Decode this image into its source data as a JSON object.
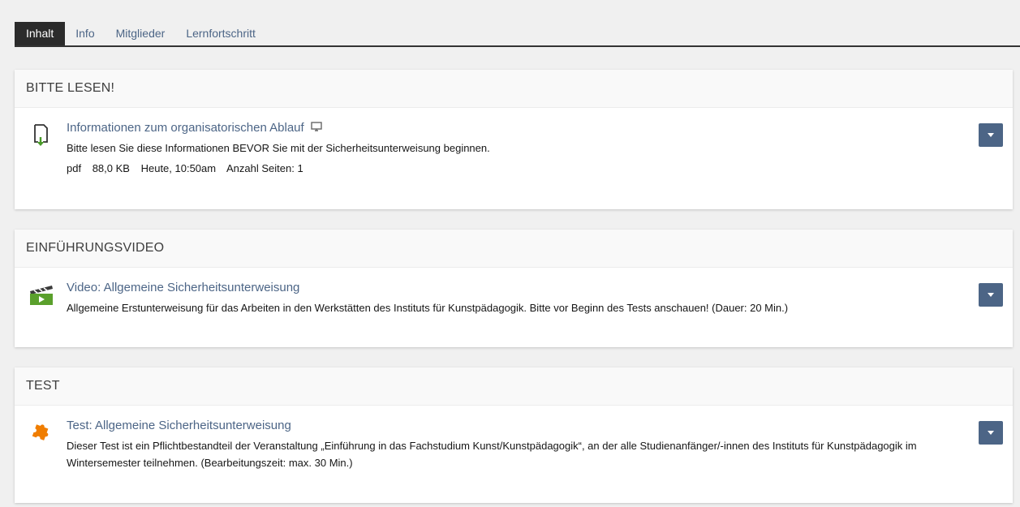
{
  "tabs": [
    {
      "label": "Inhalt",
      "active": true
    },
    {
      "label": "Info",
      "active": false
    },
    {
      "label": "Mitglieder",
      "active": false
    },
    {
      "label": "Lernfortschritt",
      "active": false
    }
  ],
  "blocks": [
    {
      "heading": "BITTE LESEN!",
      "item": {
        "icon": "file-download-icon",
        "title": "Informationen zum organisatorischen Ablauf",
        "title_icon": "monitor-icon",
        "description": "Bitte lesen Sie diese Informationen BEVOR Sie mit der Sicherheitsunterweisung beginnen.",
        "props": {
          "type": "pdf",
          "size": "88,0 KB",
          "date": "Heute, 10:50am",
          "pages": "Anzahl Seiten: 1"
        }
      }
    },
    {
      "heading": "EINFÜHRUNGSVIDEO",
      "item": {
        "icon": "video-clapper-icon",
        "title": "Video: Allgemeine Sicherheitsunterweisung",
        "description": "Allgemeine Erstunterweisung für das Arbeiten in den Werkstätten des Instituts für Kunstpädagogik. Bitte vor Beginn des Tests anschauen! (Dauer: 20 Min.)"
      }
    },
    {
      "heading": "TEST",
      "item": {
        "icon": "puzzle-test-icon",
        "title": "Test: Allgemeine Sicherheitsunterweisung",
        "description": "Dieser Test ist ein Pflichtbestandteil der Veranstaltung „Einführung in das Fachstudium Kunst/Kunstpädagogik“, an der alle Studienanfänger/-innen des Instituts für Kunstpädagogik im Wintersemester teilnehmen. (Bearbeitungszeit: max. 30 Min.)"
      }
    }
  ],
  "colors": {
    "link": "#4c6586",
    "tab_active_bg": "#2b2b2b",
    "background": "#f0f0f0",
    "dropdown_button": "#4c6586"
  }
}
